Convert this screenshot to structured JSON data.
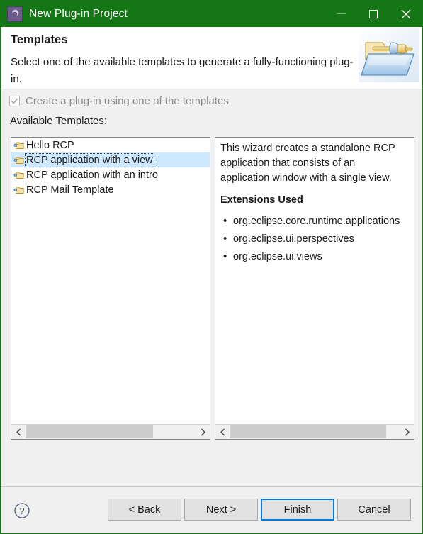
{
  "window": {
    "title": "New Plug-in Project",
    "icon": "eclipse-gear-icon",
    "accent_color": "#157615",
    "controls": {
      "minimize": "minimize-icon",
      "maximize": "maximize-icon",
      "close": "close-icon"
    }
  },
  "header": {
    "title": "Templates",
    "description": "Select one of the available templates to generate a fully-functioning plug-in.",
    "banner_icon": "plugin-folder-plug-icon"
  },
  "options": {
    "create_with_template": {
      "label": "Create a plug-in using one of the templates",
      "checked": true,
      "enabled": false
    },
    "available_templates_label": "Available Templates:"
  },
  "templates": {
    "items": [
      {
        "label": "Hello RCP",
        "icon": "template-plugin-icon",
        "selected": false
      },
      {
        "label": "RCP application with a view",
        "icon": "template-plugin-icon",
        "selected": true
      },
      {
        "label": "RCP application with an intro",
        "icon": "template-plugin-icon",
        "selected": false
      },
      {
        "label": "RCP Mail Template",
        "icon": "template-plugin-icon",
        "selected": false
      }
    ],
    "scrollbar": {
      "left_arrow": "chevron-left-icon",
      "right_arrow": "chevron-right-icon",
      "thumb_percent": 75
    }
  },
  "details": {
    "description_lines": [
      "This wizard creates a standalone RCP",
      "application that consists of an",
      "application window with a single view."
    ],
    "extensions_heading": "Extensions Used",
    "extensions": [
      "org.eclipse.core.runtime.applications",
      "org.eclipse.ui.perspectives",
      "org.eclipse.ui.views"
    ],
    "scrollbar": {
      "left_arrow": "chevron-left-icon",
      "right_arrow": "chevron-right-icon",
      "thumb_percent": 90
    }
  },
  "footer": {
    "help_icon": "help-question-icon",
    "buttons": {
      "back": "< Back",
      "next": "Next >",
      "finish": "Finish",
      "cancel": "Cancel"
    },
    "default_button": "Finish",
    "focus_color": "#0078d7"
  }
}
